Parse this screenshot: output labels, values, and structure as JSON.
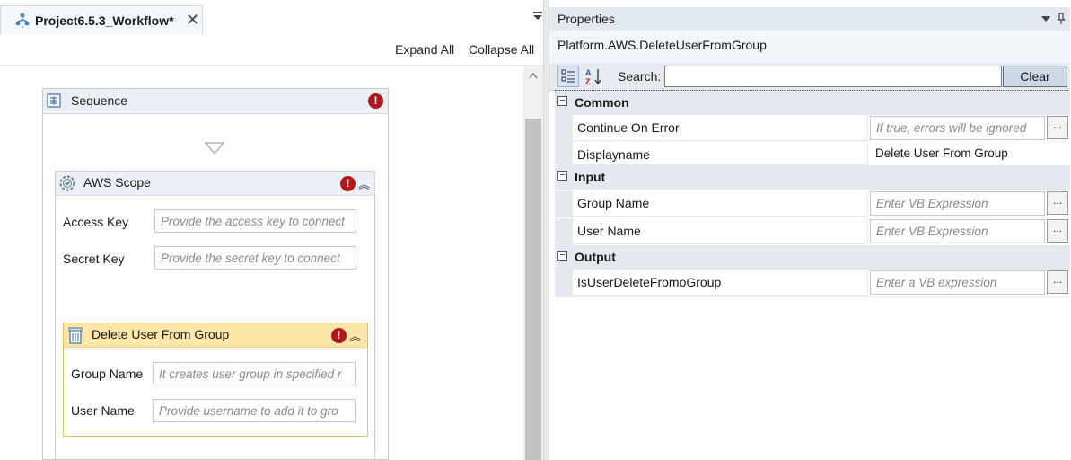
{
  "document_tab": {
    "title": "Project6.5.3_Workflow*",
    "close": "✕"
  },
  "toolbar": {
    "expand_all": "Expand All",
    "collapse_all": "Collapse All"
  },
  "sequence": {
    "title": "Sequence"
  },
  "aws_scope": {
    "title": "AWS Scope",
    "access_key_label": "Access Key",
    "access_key_placeholder": "Provide the access key to connect",
    "secret_key_label": "Secret Key",
    "secret_key_placeholder": "Provide the secret key to connect"
  },
  "delete_user_from_group": {
    "title": "Delete User From Group",
    "group_name_label": "Group Name",
    "group_name_placeholder": "It creates user group in specified r",
    "user_name_label": "User Name",
    "user_name_placeholder": "Provide username to add it to gro"
  },
  "properties": {
    "header": "Properties",
    "type_name": "Platform.AWS.DeleteUserFromGroup",
    "search_label": "Search:",
    "search_value": "",
    "clear_label": "Clear",
    "categories": [
      {
        "name": "Common",
        "rows": [
          {
            "name": "Continue On Error",
            "value": "If true, errors will be ignored",
            "placeholder": true,
            "has_button": true
          },
          {
            "name": "Displayname",
            "value": "Delete User From Group",
            "placeholder": false,
            "has_button": false
          }
        ]
      },
      {
        "name": "Input",
        "rows": [
          {
            "name": "Group Name",
            "value": "Enter VB Expression",
            "placeholder": true,
            "has_button": true
          },
          {
            "name": "User Name",
            "value": "Enter VB Expression",
            "placeholder": true,
            "has_button": true
          }
        ]
      },
      {
        "name": "Output",
        "rows": [
          {
            "name": "IsUserDeleteFromoGroup",
            "value": "Enter a VB expression",
            "placeholder": true,
            "has_button": true
          }
        ]
      }
    ],
    "ellipsis": "...",
    "collapse_glyph": "−"
  },
  "icons": {
    "error": "!",
    "collapse": "︽",
    "workflow": "workflow-icon",
    "sequence": "sequence-icon",
    "aws": "gear-icon",
    "trash": "trash-icon"
  },
  "colors": {
    "error_red": "#b3171d",
    "activity_header": "#eaf0f6",
    "selected_activity_header": "#fde7a8",
    "properties_header": "#e3e9f0",
    "clear_button": "#cbd8e6"
  }
}
